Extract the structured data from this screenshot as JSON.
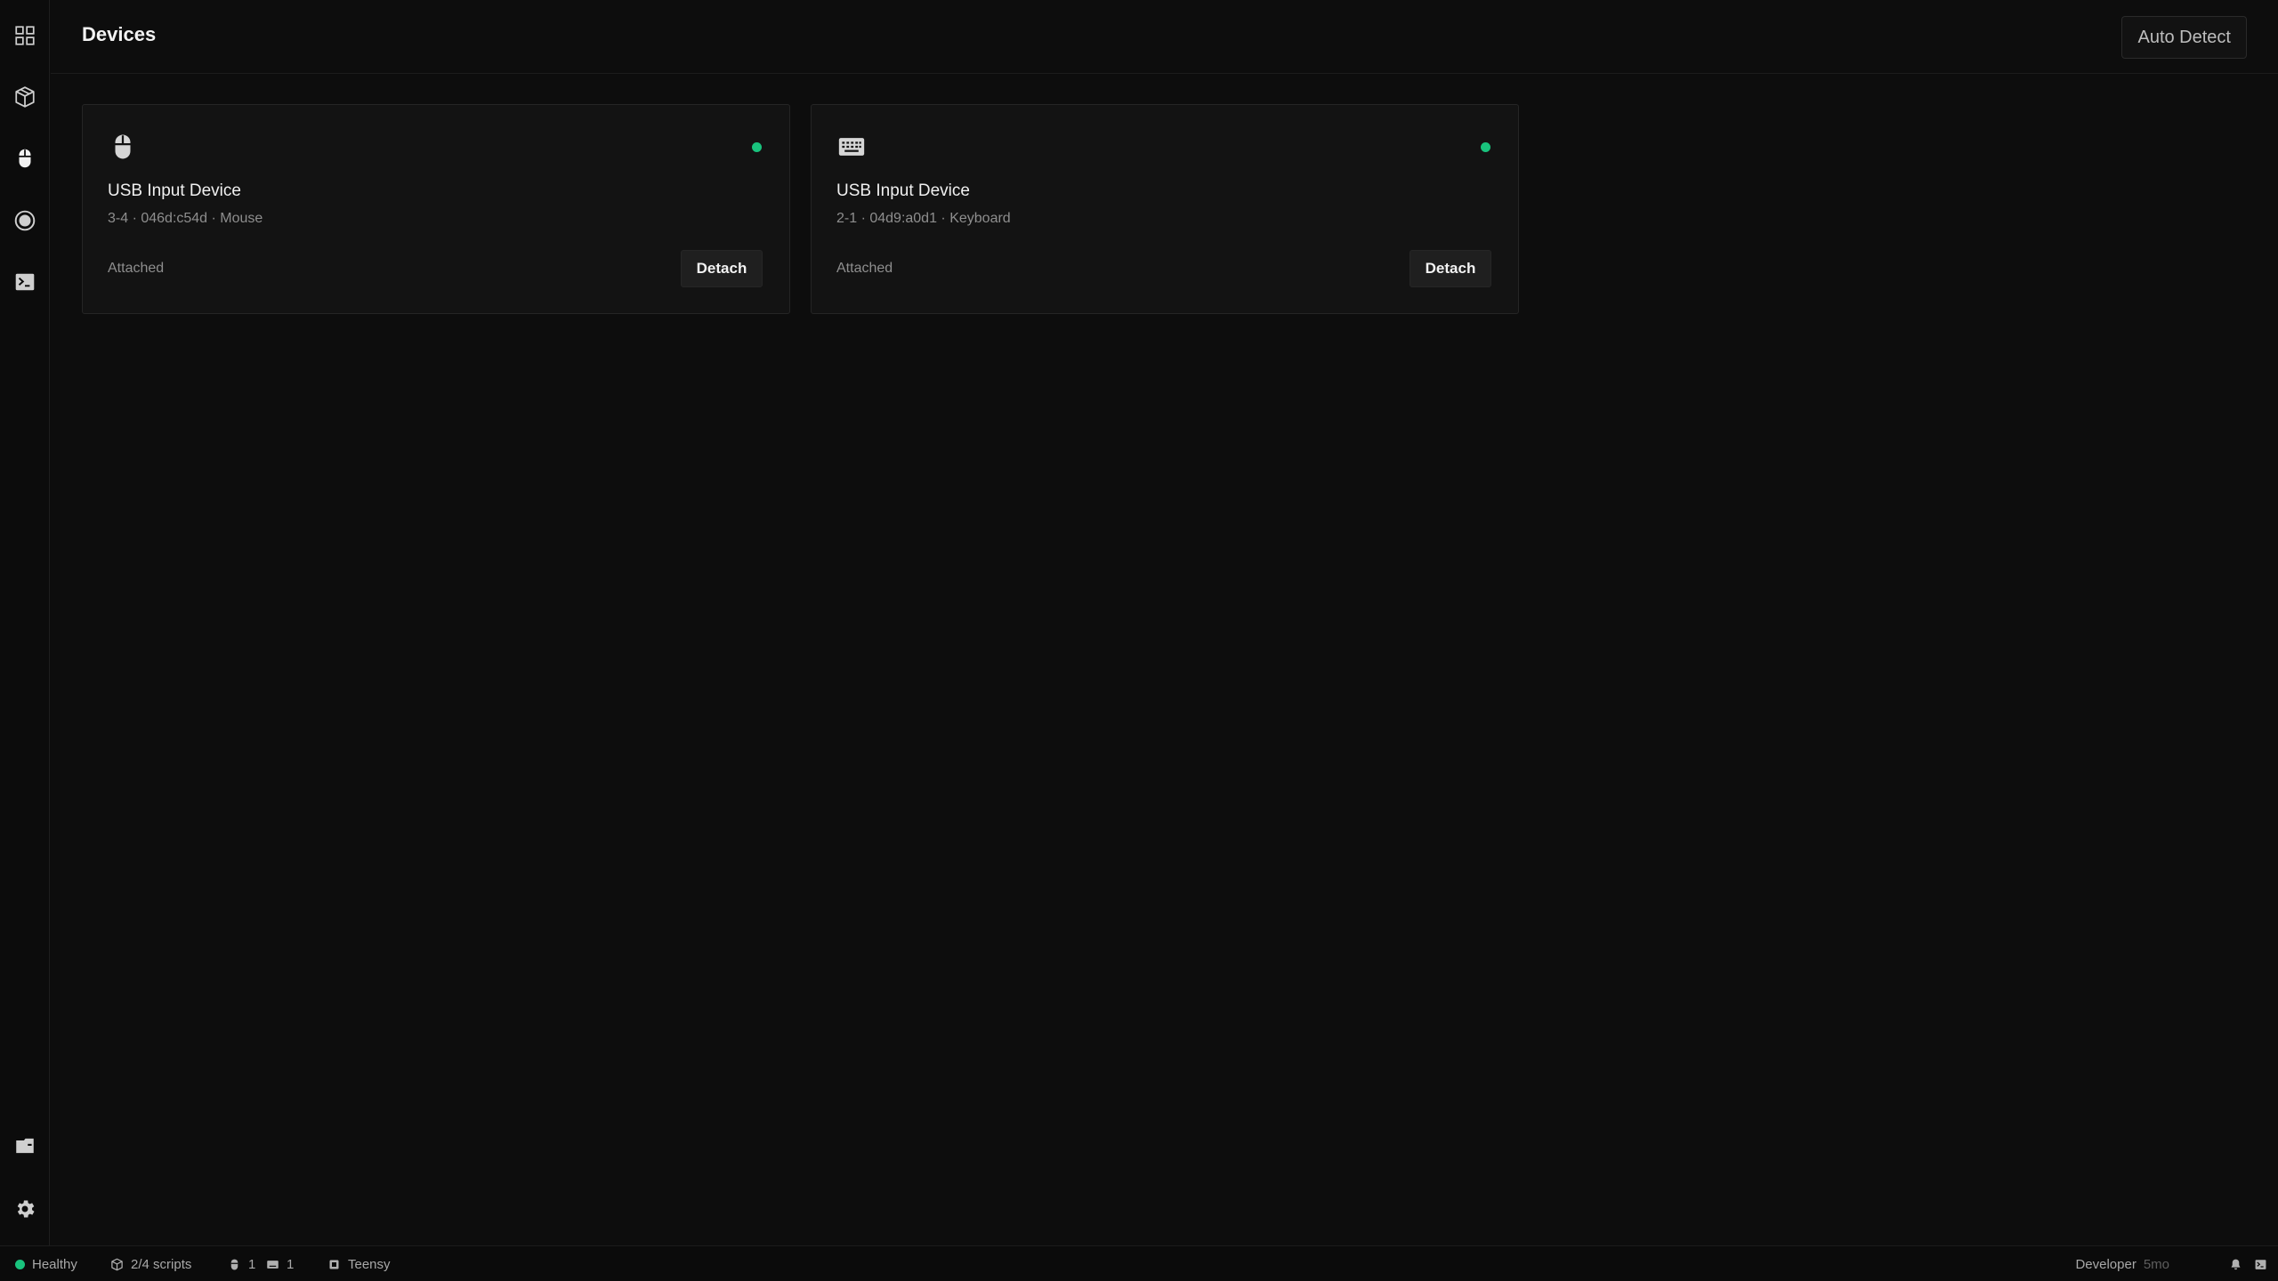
{
  "header": {
    "title": "Devices",
    "auto_detect_label": "Auto Detect"
  },
  "sidebar": {
    "top_items": [
      {
        "name": "dashboard",
        "icon": "grid-icon"
      },
      {
        "name": "scripts",
        "icon": "package-icon"
      },
      {
        "name": "devices",
        "icon": "mouse-icon",
        "active": true
      },
      {
        "name": "record",
        "icon": "record-icon"
      },
      {
        "name": "console",
        "icon": "terminal-icon"
      }
    ],
    "bottom_items": [
      {
        "name": "storage",
        "icon": "drawer-icon"
      },
      {
        "name": "settings",
        "icon": "gear-icon"
      }
    ]
  },
  "devices": [
    {
      "name": "USB Input Device",
      "meta": "3-4 · 046d:c54d · Mouse",
      "type_icon": "mouse-icon",
      "status": "Attached",
      "action_label": "Detach",
      "connected": true
    },
    {
      "name": "USB Input Device",
      "meta": "2-1 · 04d9:a0d1 · Keyboard",
      "type_icon": "keyboard-icon",
      "status": "Attached",
      "action_label": "Detach",
      "connected": true
    }
  ],
  "statusbar": {
    "health": "Healthy",
    "scripts": "2/4 scripts",
    "mouse_count": "1",
    "keyboard_count": "1",
    "device": "Teensy",
    "mode": "Developer",
    "age": "5mo"
  },
  "colors": {
    "background": "#0d0d0d",
    "card": "#131313",
    "accent_green": "#19c37d",
    "text_primary": "#f0f0f0",
    "text_muted": "#8e8e8e"
  }
}
